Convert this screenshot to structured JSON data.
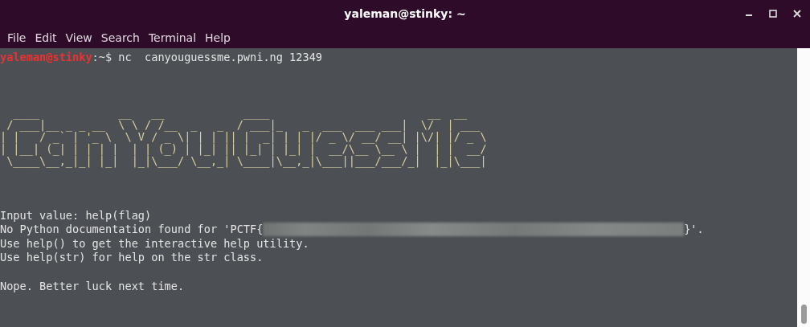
{
  "window": {
    "title": "yaleman@stinky: ~"
  },
  "menu": [
    "File",
    "Edit",
    "View",
    "Search",
    "Terminal",
    "Help"
  ],
  "prompt": {
    "user_host": "yaleman@stinky",
    "path": ":~$",
    "command": "nc  canyouguessme.pwni.ng 12349"
  },
  "banner": [
    "  ____            __   __            ____                        __  __      ",
    " / ___|__ _ _ __  \\ \\ / /__  _   _  / ___|_   _  ___  ___ ___|  \\/  | ___ ",
    "| |   / _` | '_ \\  \\ V / _ \\| | | || |  _| | | |/ _ \\/ __/ __| |\\/| |/ _ \\",
    "| |__| (_| | | | |  | | (_) | |_| || |_| | |_| |  __/\\__ \\__ \\ |  | |  __/",
    " \\____\\__,_|_| |_|  |_|\\___/ \\__,_| \\____|\\__,_|\\___||___/___/_|  |_|\\___|"
  ],
  "output": [
    {
      "kind": "text",
      "text": "Input value: help(flag)"
    },
    {
      "kind": "redacted",
      "before": "No Python documentation found for 'PCTF{",
      "after": "}'."
    },
    {
      "kind": "text",
      "text": "Use help() to get the interactive help utility."
    },
    {
      "kind": "text",
      "text": "Use help(str) for help on the str class."
    },
    {
      "kind": "blank"
    },
    {
      "kind": "text",
      "text": "Nope. Better luck next time."
    }
  ]
}
